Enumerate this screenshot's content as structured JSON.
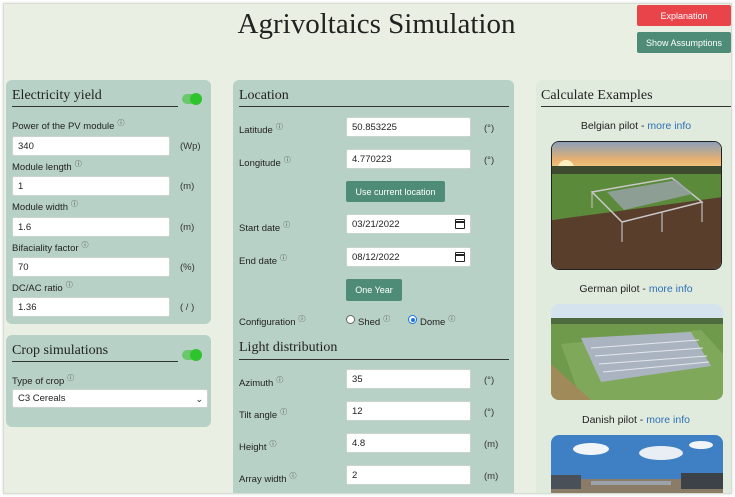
{
  "header": {
    "title": "Agrivoltaics Simulation",
    "explanation_label": "Explanation",
    "assumptions_label": "Show Assumptions"
  },
  "electricity": {
    "title": "Electricity yield",
    "toggle_on": true,
    "fields": [
      {
        "label": "Power of the PV module",
        "value": "340",
        "unit": "(Wp)"
      },
      {
        "label": "Module length",
        "value": "1",
        "unit": "(m)"
      },
      {
        "label": "Module width",
        "value": "1.6",
        "unit": "(m)"
      },
      {
        "label": "Bifaciality factor",
        "value": "70",
        "unit": "(%)"
      },
      {
        "label": "DC/AC ratio",
        "value": "1.36",
        "unit": "( / )"
      }
    ]
  },
  "crop": {
    "title": "Crop simulations",
    "toggle_on": true,
    "type_label": "Type of crop",
    "type_value": "C3 Cereals"
  },
  "location": {
    "title": "Location",
    "latitude_label": "Latitude",
    "latitude_value": "50.853225",
    "latitude_unit": "(°)",
    "longitude_label": "Longitude",
    "longitude_value": "4.770223",
    "longitude_unit": "(°)",
    "use_location_label": "Use current location",
    "start_label": "Start date",
    "start_value": "03/21/2022",
    "end_label": "End date",
    "end_value": "08/12/2022",
    "one_year_label": "One Year",
    "config_label": "Configuration",
    "config_options": [
      "Shed",
      "Dome"
    ],
    "config_selected": "Dome"
  },
  "light": {
    "title": "Light distribution",
    "fields": [
      {
        "label": "Azimuth",
        "value": "35",
        "unit": "(°)"
      },
      {
        "label": "Tilt angle",
        "value": "12",
        "unit": "(°)"
      },
      {
        "label": "Height",
        "value": "4.8",
        "unit": "(m)"
      },
      {
        "label": "Array width",
        "value": "2",
        "unit": "(m)"
      }
    ]
  },
  "examples": {
    "title": "Calculate Examples",
    "items": [
      {
        "name": "Belgian pilot - ",
        "link": "more info"
      },
      {
        "name": "German pilot - ",
        "link": "more info"
      },
      {
        "name": "Danish pilot - ",
        "link": "more info"
      }
    ]
  },
  "icons": {
    "help": "ⓘ",
    "chevron": "⌄"
  }
}
